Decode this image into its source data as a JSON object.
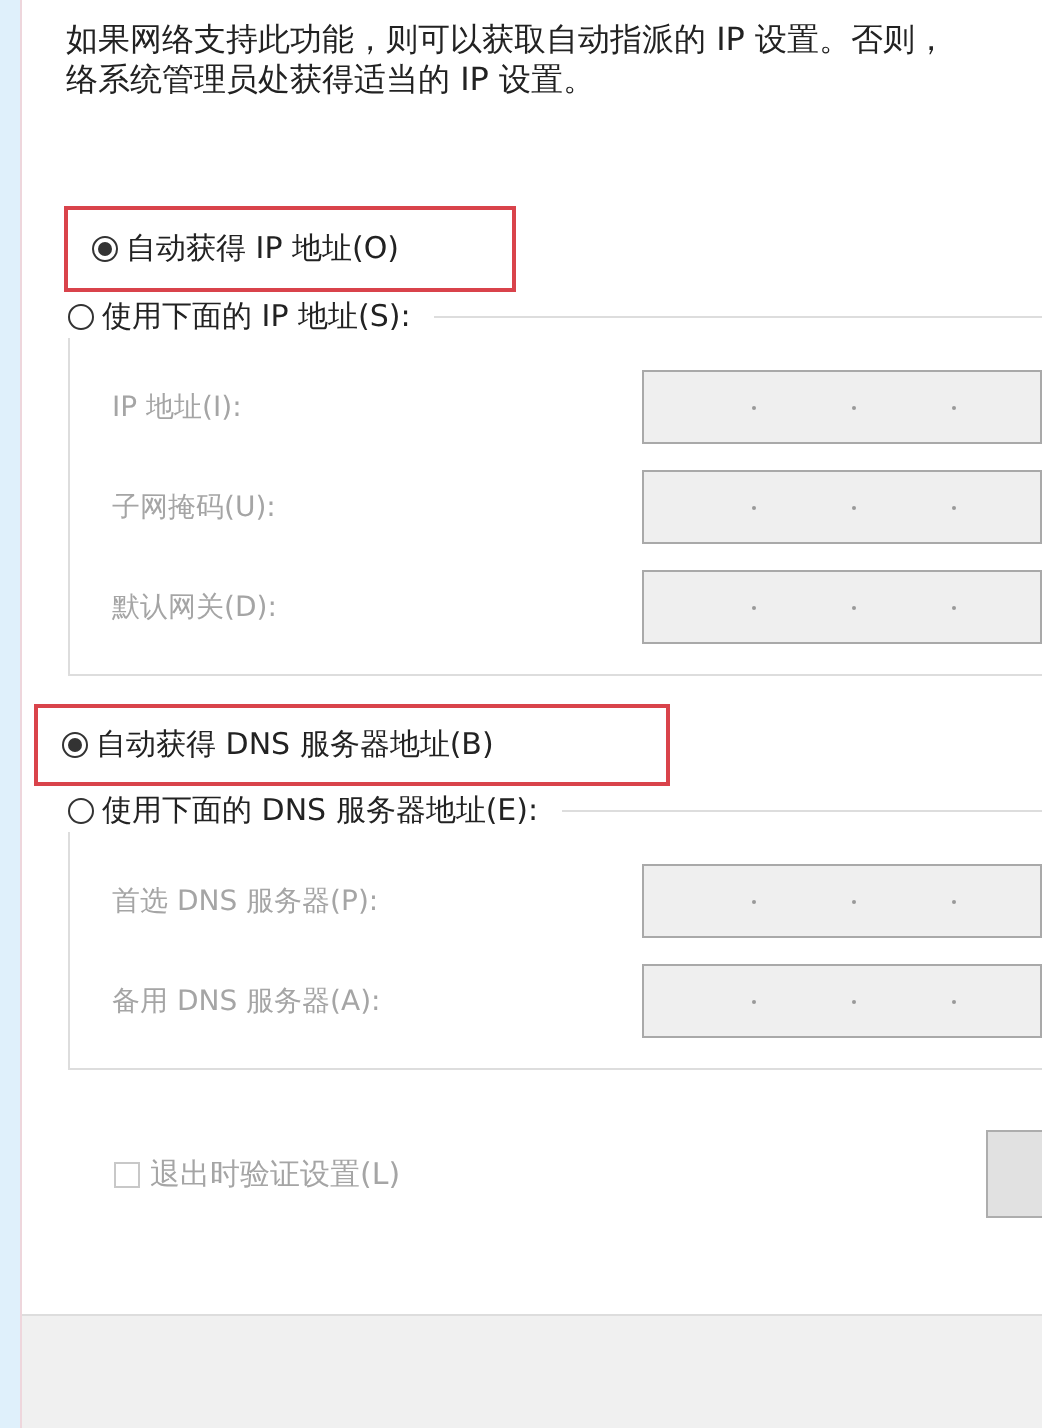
{
  "description": [
    "如果网络支持此功能，则可以获取自动指派的 IP 设置。否则，",
    "络系统管理员处获得适当的 IP 设置。"
  ],
  "sections": [
    {
      "options": [
        {
          "label": "自动获得 IP 地址(O)",
          "selected": true,
          "highlighted": true
        },
        {
          "label": "使用下面的 IP 地址(S):",
          "selected": false,
          "highlighted": false
        }
      ],
      "fields": [
        {
          "label": "IP 地址(I):",
          "disabled": true
        },
        {
          "label": "子网掩码(U):",
          "disabled": true
        },
        {
          "label": "默认网关(D):",
          "disabled": true
        }
      ]
    },
    {
      "options": [
        {
          "label": "自动获得 DNS 服务器地址(B)",
          "selected": true,
          "highlighted": true
        },
        {
          "label": "使用下面的 DNS 服务器地址(E):",
          "selected": false,
          "highlighted": false
        }
      ],
      "fields": [
        {
          "label": "首选 DNS 服务器(P):",
          "disabled": true
        },
        {
          "label": "备用 DNS 服务器(A):",
          "disabled": true
        }
      ]
    }
  ],
  "checkbox": {
    "label": "退出时验证设置(L)",
    "checked": false,
    "disabled": true
  }
}
